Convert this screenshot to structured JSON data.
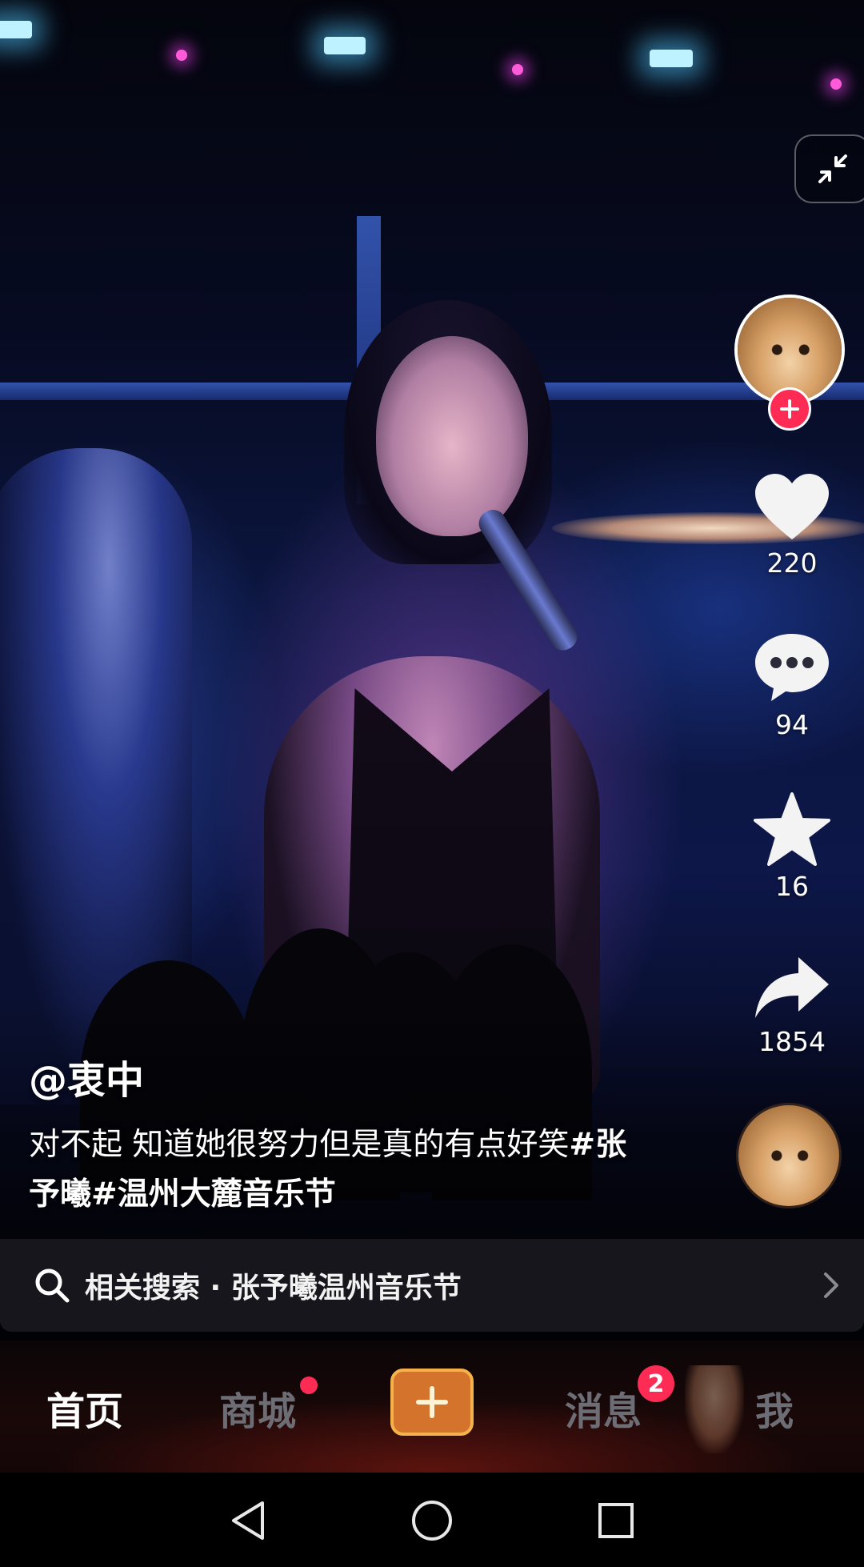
{
  "video": {
    "author": "@衷中",
    "caption_text": "对不起 知道她很努力但是真的有点好笑",
    "hashtags": [
      "#张予曦",
      "#温州大麓音乐节"
    ]
  },
  "actions": {
    "follow_icon": "plus-icon",
    "like_count": "220",
    "comment_count": "94",
    "favorite_count": "16",
    "share_count": "1854"
  },
  "related_search": {
    "label": "相关搜索 · 张予曦温州音乐节"
  },
  "tabbar": {
    "items": [
      {
        "label": "首页",
        "active": true
      },
      {
        "label": "商城",
        "has_dot": true
      },
      {
        "label": "",
        "icon": "plus-icon"
      },
      {
        "label": "消息",
        "badge": "2"
      },
      {
        "label": "我"
      }
    ]
  },
  "system_nav": {
    "buttons": [
      "back-icon",
      "home-icon",
      "recents-icon"
    ]
  },
  "colors": {
    "accent_red": "#fe2c55",
    "create_button": "#d4742c"
  }
}
